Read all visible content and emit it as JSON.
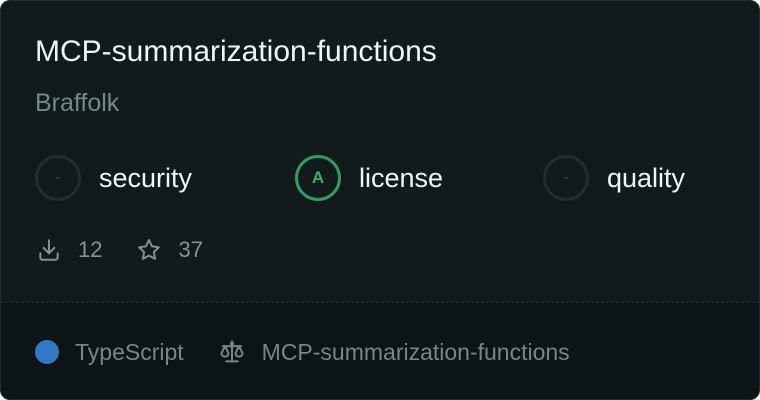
{
  "card": {
    "title": "MCP-summarization-functions",
    "author": "Braffolk",
    "badges": [
      {
        "grade": "-",
        "label": "security",
        "grade_color": "#3b4043"
      },
      {
        "grade": "A",
        "label": "license",
        "grade_color": "#2f9e61"
      },
      {
        "grade": "-",
        "label": "quality",
        "grade_color": "#3b4043"
      }
    ],
    "stats": {
      "downloads": "12",
      "downloads_icon": "download-icon",
      "stars": "37",
      "stars_icon": "star-icon"
    },
    "footer": {
      "language": "TypeScript",
      "language_color": "#3178c6",
      "license_icon": "scale-icon",
      "repo_name": "MCP-summarization-functions"
    }
  }
}
